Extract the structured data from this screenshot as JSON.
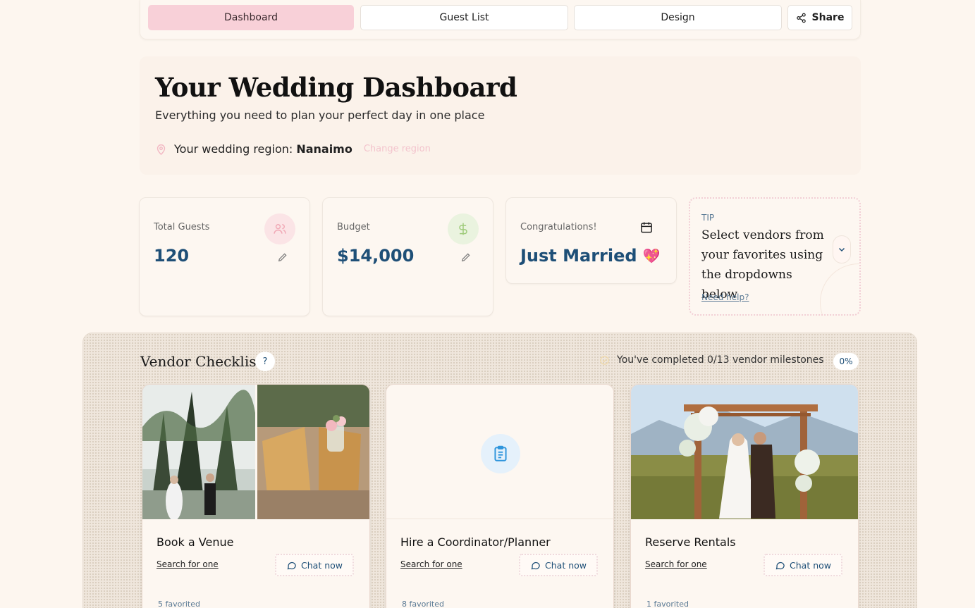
{
  "nav": {
    "tabs": [
      {
        "label": "Dashboard",
        "active": true
      },
      {
        "label": "Guest List",
        "active": false
      },
      {
        "label": "Design",
        "active": false
      }
    ],
    "share_label": "Share"
  },
  "hero": {
    "title": "Your Wedding Dashboard",
    "subtitle": "Everything you need to plan your perfect day in one place",
    "region_prefix": "Your wedding region:",
    "region_name": "Nanaimo",
    "change_region": "Change region"
  },
  "stats": {
    "guests": {
      "label": "Total Guests",
      "value": "120"
    },
    "budget": {
      "label": "Budget",
      "value": "$14,000"
    },
    "status": {
      "label": "Congratulations!",
      "value": "Just Married",
      "emoji": "💖"
    }
  },
  "tip": {
    "label": "TIP",
    "text": "Select vendors from your favorites using the dropdowns below",
    "help_link": "Need help?"
  },
  "checklist": {
    "title": "Vendor Checklist",
    "help": "?",
    "progress_text": "You've completed 0/13 vendor milestones",
    "percent": "0%",
    "vendors": [
      {
        "title": "Book a Venue",
        "search": "Search for one",
        "chat": "Chat now",
        "favorited": "5 favorited"
      },
      {
        "title": "Hire a Coordinator/Planner",
        "search": "Search for one",
        "chat": "Chat now",
        "favorited": "8 favorited"
      },
      {
        "title": "Reserve Rentals",
        "search": "Search for one",
        "chat": "Chat now",
        "favorited": "1 favorited"
      }
    ]
  },
  "colors": {
    "accent_pink": "#f8d0d8",
    "primary_blue": "#1e4f77",
    "background": "#fdf6ef"
  }
}
